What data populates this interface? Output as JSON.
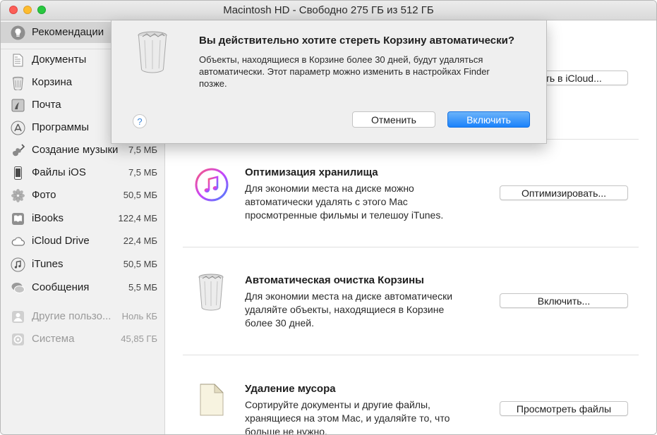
{
  "window": {
    "title": "Macintosh HD - Свободно 275 ГБ из 512 ГБ"
  },
  "colors": {
    "accent": "#1a82fb",
    "sidebar_bg": "#f1f1f1",
    "selected_bg": "#d3d3d3"
  },
  "sidebar": {
    "items": [
      {
        "label": "Рекомендации",
        "size": "",
        "icon": "lightbulb-icon"
      },
      {
        "label": "Документы",
        "size": "",
        "icon": "document-icon"
      },
      {
        "label": "Корзина",
        "size": "",
        "icon": "trash-icon"
      },
      {
        "label": "Почта",
        "size": "",
        "icon": "mail-icon"
      },
      {
        "label": "Программы",
        "size": "",
        "icon": "app-store-icon"
      },
      {
        "label": "Создание музыки",
        "size": "7,5 МБ",
        "icon": "guitar-icon"
      },
      {
        "label": "Файлы iOS",
        "size": "7,5 МБ",
        "icon": "iphone-icon"
      },
      {
        "label": "Фото",
        "size": "50,5 МБ",
        "icon": "photos-icon"
      },
      {
        "label": "iBooks",
        "size": "122,4 МБ",
        "icon": "book-icon"
      },
      {
        "label": "iCloud Drive",
        "size": "22,4 МБ",
        "icon": "cloud-icon"
      },
      {
        "label": "iTunes",
        "size": "50,5 МБ",
        "icon": "music-note-icon"
      },
      {
        "label": "Сообщения",
        "size": "5,5 МБ",
        "icon": "messages-icon"
      },
      {
        "label": "Другие пользо...",
        "size": "Ноль КБ",
        "icon": "user-icon"
      },
      {
        "label": "Система",
        "size": "45,85 ГБ",
        "icon": "system-icon"
      }
    ]
  },
  "main": {
    "icloud_button": "...нить в iCloud...",
    "sections": [
      {
        "title": "Оптимизация хранилища",
        "description": "Для экономии места на диске можно автоматически удалять с этого Mac просмотренные фильмы и телешоу iTunes.",
        "button": "Оптимизировать...",
        "icon": "itunes-icon"
      },
      {
        "title": "Автоматическая очистка Корзины",
        "description": "Для экономии места на диске автоматически удаляйте объекты, находящиеся в Корзине более 30 дней.",
        "button": "Включить...",
        "icon": "trash-icon"
      },
      {
        "title": "Удаление мусора",
        "description": "Сортируйте документы и другие файлы, хранящиеся на этом Mac, и удаляйте то, что больше не нужно.",
        "button": "Просмотреть файлы",
        "icon": "document-icon"
      }
    ]
  },
  "dialog": {
    "title": "Вы действительно хотите стереть Корзину автоматически?",
    "message": "Объекты, находящиеся в Корзине более 30 дней, будут удаляться автоматически. Этот параметр можно изменить в настройках Finder позже.",
    "help": "?",
    "cancel_label": "Отменить",
    "confirm_label": "Включить"
  }
}
